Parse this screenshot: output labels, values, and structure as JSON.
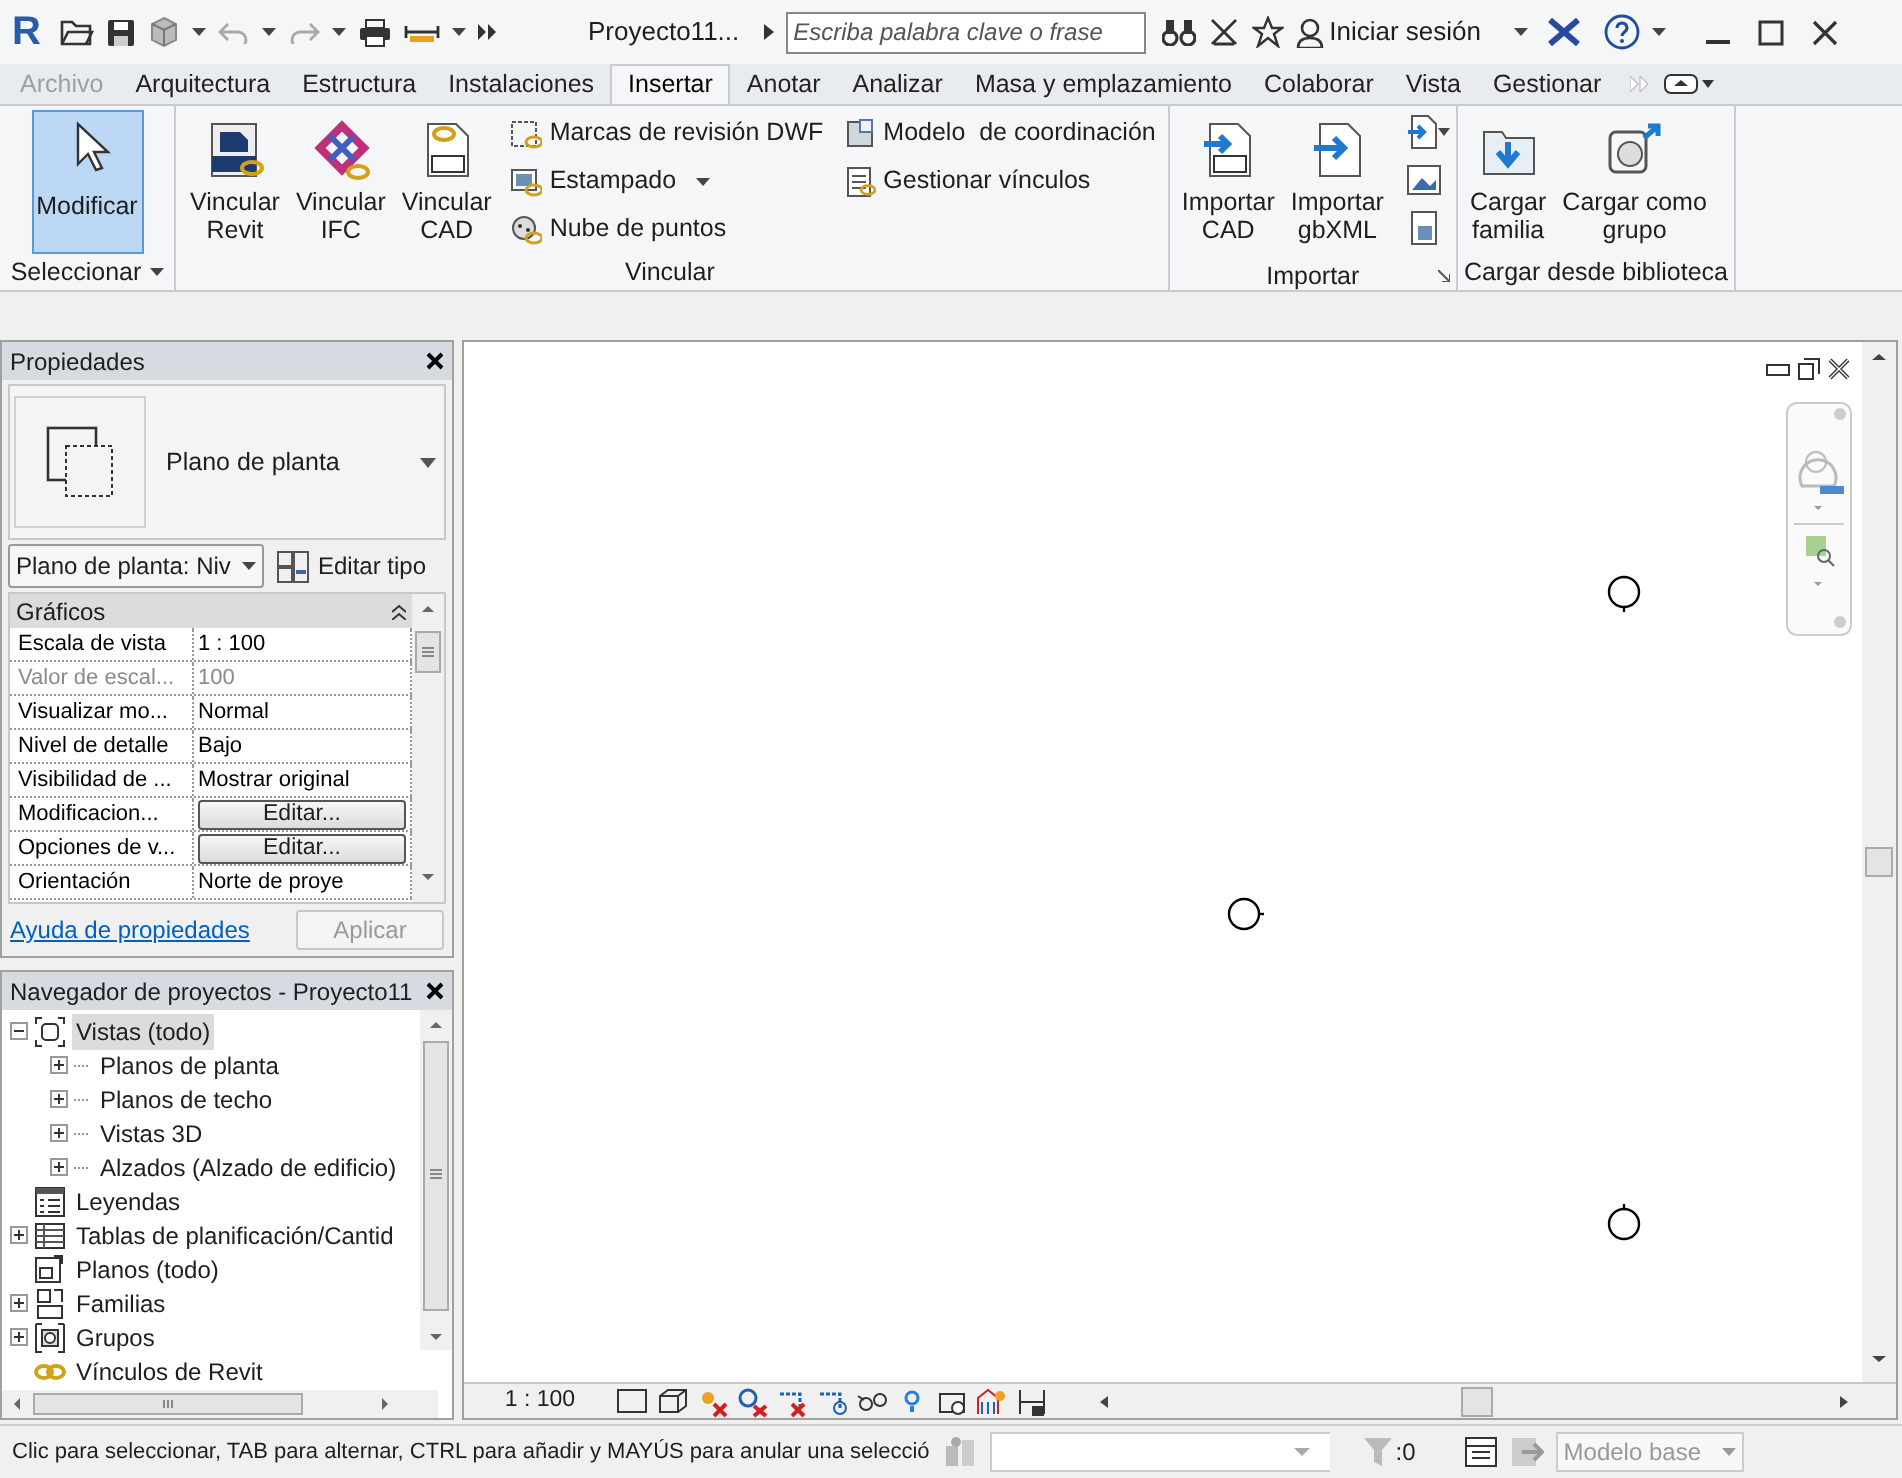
{
  "title_bar": {
    "app_logo": "R",
    "project": "Proyecto11...",
    "search": {
      "placeholder": "Escriba palabra clave o frase"
    },
    "sign_in": "Iniciar sesión"
  },
  "tabs": [
    {
      "label": "Archivo",
      "selected": false,
      "kind": "file"
    },
    {
      "label": "Arquitectura",
      "selected": false,
      "kind": "tab"
    },
    {
      "label": "Estructura",
      "selected": false,
      "kind": "tab"
    },
    {
      "label": "Instalaciones",
      "selected": false,
      "kind": "tab"
    },
    {
      "label": "Insertar",
      "selected": true,
      "kind": "tab"
    },
    {
      "label": "Anotar",
      "selected": false,
      "kind": "tab"
    },
    {
      "label": "Analizar",
      "selected": false,
      "kind": "tab"
    },
    {
      "label": "Masa y emplazamiento",
      "selected": false,
      "kind": "tab"
    },
    {
      "label": "Colaborar",
      "selected": false,
      "kind": "tab"
    },
    {
      "label": "Vista",
      "selected": false,
      "kind": "tab"
    },
    {
      "label": "Gestionar",
      "selected": false,
      "kind": "tab"
    }
  ],
  "ribbon": [
    {
      "title": "Seleccionar",
      "large": [
        {
          "label": "Modificar",
          "selected": true
        }
      ]
    },
    {
      "title": "Vincular",
      "large": [
        {
          "label": "Vincular\nRevit",
          "selected": false
        },
        {
          "label": "Vincular\nIFC",
          "selected": false
        },
        {
          "label": "Vincular\nCAD",
          "selected": false
        }
      ],
      "small": [
        {
          "label": "Marcas de revisión DWF"
        },
        {
          "label": "Estampado"
        },
        {
          "label": "Nube de puntos"
        },
        {
          "label": "Modelo  de coordinación"
        },
        {
          "label": "Gestionar vínculos"
        }
      ]
    },
    {
      "title": "Importar",
      "large": [
        {
          "label": "Importar\nCAD",
          "selected": false
        },
        {
          "label": "Importar\ngbXML",
          "selected": false
        }
      ]
    },
    {
      "title": "Cargar desde biblioteca",
      "large": [
        {
          "label": "Cargar\nfamilia",
          "selected": false
        },
        {
          "label": "Cargar como\ngrupo",
          "selected": false
        }
      ]
    }
  ],
  "properties": {
    "title": "Propiedades",
    "type_name": "Plano de planta",
    "type_selector": "Plano de planta: Niv",
    "edit_type": "Editar tipo",
    "group": "Gráficos",
    "rows": [
      {
        "name": "Escala de vista",
        "value": "1 : 100",
        "kind": "text",
        "disabled": false
      },
      {
        "name": "Valor de escal...",
        "value": "100",
        "kind": "text",
        "disabled": true
      },
      {
        "name": "Visualizar mo...",
        "value": "Normal",
        "kind": "text",
        "disabled": false
      },
      {
        "name": "Nivel de detalle",
        "value": "Bajo",
        "kind": "text",
        "disabled": false
      },
      {
        "name": "Visibilidad de ...",
        "value": "Mostrar original",
        "kind": "text",
        "disabled": false
      },
      {
        "name": "Modificacion...",
        "value": "Editar...",
        "kind": "button",
        "disabled": false
      },
      {
        "name": "Opciones de v...",
        "value": "Editar...",
        "kind": "button",
        "disabled": false
      },
      {
        "name": "Orientación",
        "value": "Norte de proye",
        "kind": "text",
        "disabled": false
      }
    ],
    "help_link": "Ayuda de propiedades",
    "apply": {
      "label": "Aplicar",
      "disabled": true
    }
  },
  "browser": {
    "title": "Navegador de proyectos - Proyecto11",
    "tree": [
      {
        "label": "Vistas (todo)",
        "expanded": true,
        "selected": true,
        "children": [
          {
            "label": "Planos de planta",
            "expanded": false,
            "selected": false
          },
          {
            "label": "Planos de techo",
            "expanded": false,
            "selected": false
          },
          {
            "label": "Vistas 3D",
            "expanded": false,
            "selected": false
          },
          {
            "label": "Alzados (Alzado de edificio)",
            "expanded": false,
            "selected": false
          }
        ]
      },
      {
        "label": "Leyendas",
        "selected": false
      },
      {
        "label": "Tablas de planificación/Cantid",
        "expanded": false,
        "selected": false
      },
      {
        "label": "Planos (todo)",
        "selected": false
      },
      {
        "label": "Familias",
        "expanded": false,
        "selected": false
      },
      {
        "label": "Grupos",
        "expanded": false,
        "selected": false
      },
      {
        "label": "Vínculos de Revit",
        "selected": false
      }
    ]
  },
  "view": {
    "scale": "1 : 100"
  },
  "status_bar": {
    "message": "Clic para seleccionar, TAB para alternar, CTRL para añadir y MAYÚS para anular una selecció",
    "filter_count": ":0",
    "model": "Modelo base"
  }
}
